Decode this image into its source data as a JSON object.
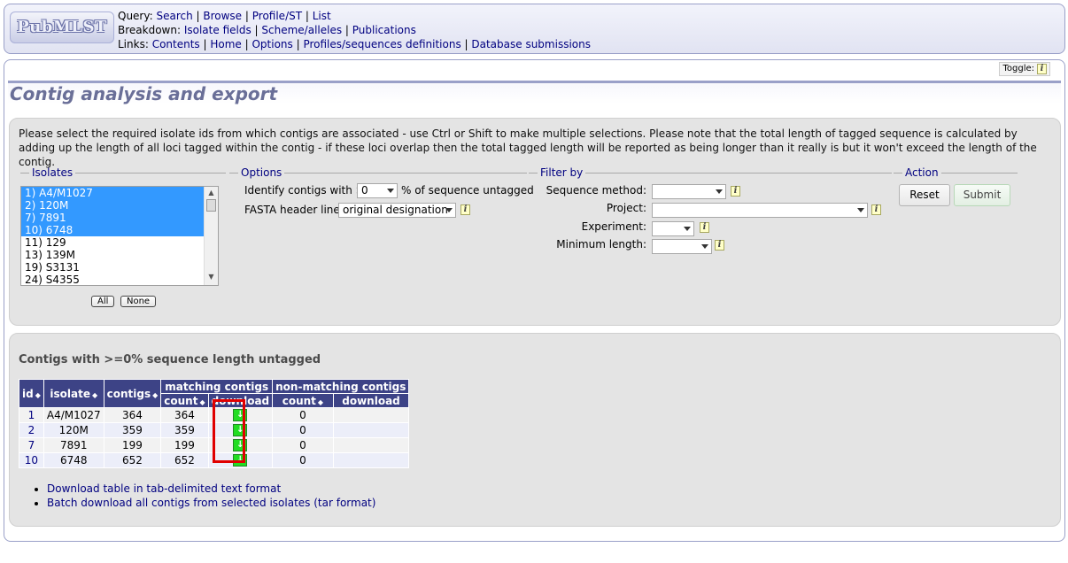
{
  "logo": {
    "text": "PubMLST"
  },
  "menu": {
    "query_label": "Query:",
    "query_links": [
      "Search",
      "Browse",
      "Profile/ST",
      "List"
    ],
    "breakdown_label": "Breakdown:",
    "breakdown_links": [
      "Isolate fields",
      "Scheme/alleles",
      "Publications"
    ],
    "links_label": "Links:",
    "links_links": [
      "Contents",
      "Home",
      "Options",
      "Profiles/sequences definitions",
      "Database submissions"
    ],
    "separator": " | "
  },
  "toggle": {
    "label": "Toggle:",
    "icon": "info-icon"
  },
  "page_title": "Contig analysis and export",
  "intro": "Please select the required isolate ids from which contigs are associated - use Ctrl or Shift to make multiple selections. Please note that the total length of tagged sequence is calculated by adding up the length of all loci tagged within the contig - if these loci overlap then the total tagged length will be reported as being longer than it really is but it won't exceed the length of the contig.",
  "isolates": {
    "legend": "Isolates",
    "options": [
      {
        "label": "1) A4/M1027",
        "selected": true
      },
      {
        "label": "2) 120M",
        "selected": true
      },
      {
        "label": "7) 7891",
        "selected": true
      },
      {
        "label": "10) 6748",
        "selected": true
      },
      {
        "label": "11) 129",
        "selected": false
      },
      {
        "label": "13) 139M",
        "selected": false
      },
      {
        "label": "19) S3131",
        "selected": false
      },
      {
        "label": "24) S4355",
        "selected": false
      }
    ],
    "all_label": "All",
    "none_label": "None"
  },
  "options": {
    "legend": "Options",
    "identify_label": "Identify contigs with >=",
    "identify_value": "0",
    "identify_suffix": "% of sequence untagged",
    "fasta_label": "FASTA header line:",
    "fasta_value": "original designation"
  },
  "filter": {
    "legend": "Filter by",
    "sequence_method_label": "Sequence method:",
    "sequence_method_value": "",
    "project_label": "Project:",
    "project_value": "",
    "experiment_label": "Experiment:",
    "experiment_value": "",
    "min_length_label": "Minimum length:",
    "min_length_value": ""
  },
  "action": {
    "legend": "Action",
    "reset_label": "Reset",
    "submit_label": "Submit"
  },
  "results": {
    "heading": "Contigs with >=0% sequence length untagged",
    "headers": {
      "id": "id",
      "isolate": "isolate",
      "contigs": "contigs",
      "matching": "matching contigs",
      "non_matching": "non-matching contigs",
      "count": "count",
      "download": "download",
      "sort_glyph": "◆"
    },
    "rows": [
      {
        "id": "1",
        "isolate": "A4/M1027",
        "contigs": "364",
        "match_count": "364",
        "nonmatch_count": "0"
      },
      {
        "id": "2",
        "isolate": "120M",
        "contigs": "359",
        "match_count": "359",
        "nonmatch_count": "0"
      },
      {
        "id": "7",
        "isolate": "7891",
        "contigs": "199",
        "match_count": "199",
        "nonmatch_count": "0"
      },
      {
        "id": "10",
        "isolate": "6748",
        "contigs": "652",
        "match_count": "652",
        "nonmatch_count": "0"
      }
    ],
    "download_icon": "download-arrow-icon",
    "download_glyph": "↓",
    "links": [
      "Download table in tab-delimited text format",
      "Batch download all contigs from selected isolates (tar format)"
    ]
  },
  "colors": {
    "table_header": "#3d4386",
    "selection": "#3399ff",
    "highlight_box": "#e00000",
    "download_icon": "#22dd22"
  }
}
